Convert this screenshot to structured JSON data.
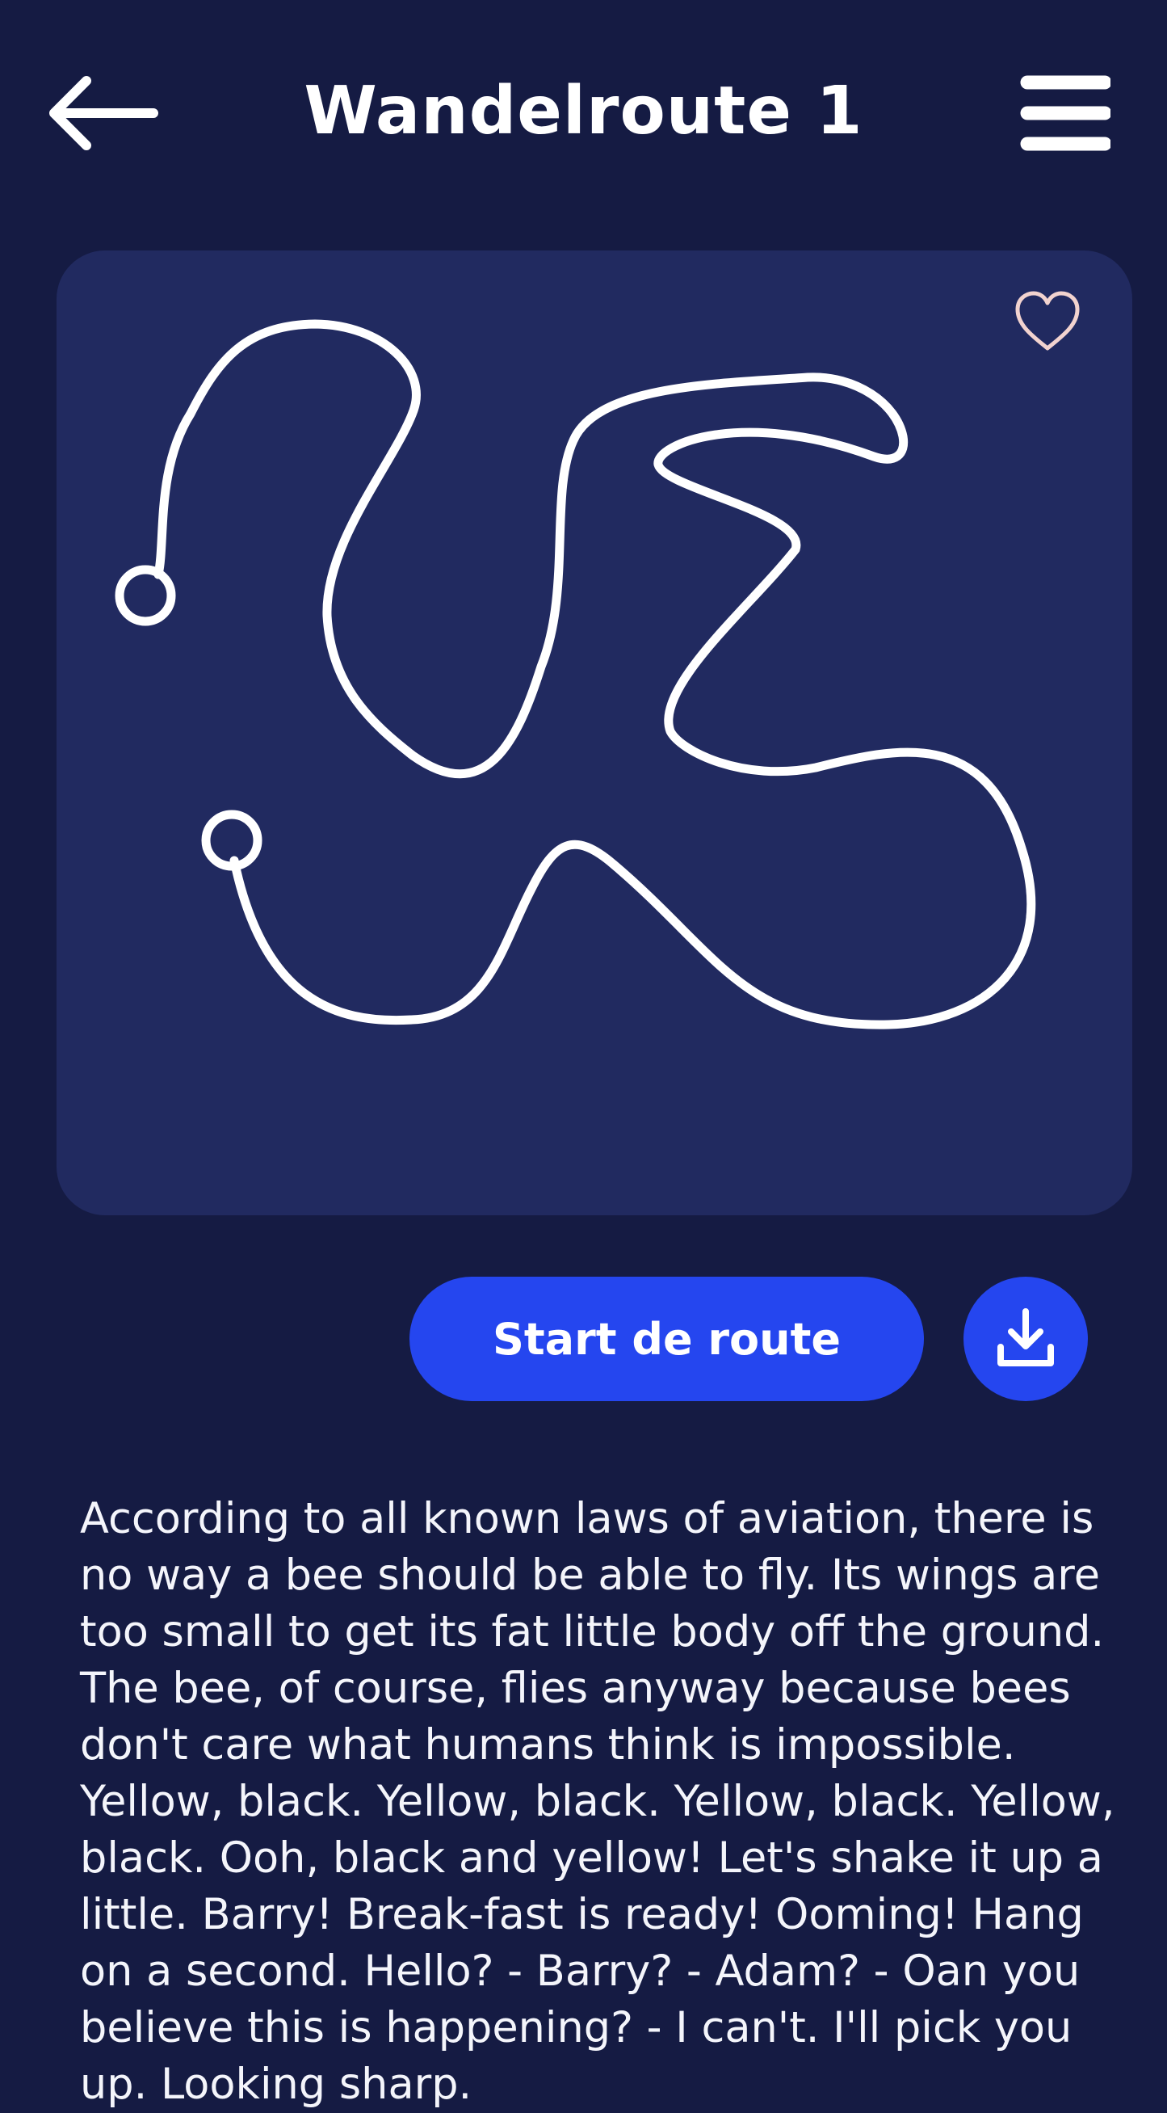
{
  "header": {
    "title": "Wandelroute 1",
    "back_icon": "arrow-left-icon",
    "menu_icon": "hamburger-menu-icon"
  },
  "map": {
    "favorite_icon": "heart-outline-icon",
    "route_icon": "route-path",
    "start_marker": "circle-marker",
    "end_marker": "circle-marker"
  },
  "actions": {
    "start_label": "Start de route",
    "download_icon": "download-icon"
  },
  "description": "According to all known laws of aviation, there is no way a bee should be able to fly. Its wings are too small to get its fat little body off the ground. The bee, of course, flies anyway because bees don't care what humans think is impossible. Yellow, black. Yellow, black. Yellow, black. Yellow, black. Ooh, black and yellow! Let's shake it up a little. Barry! Break-fast is ready! Ooming! Hang on a second. Hello? - Barry? - Adam? - Oan you believe this is happening? - I can't. I'll pick you up. Looking sharp.",
  "colors": {
    "background": "#151b43",
    "card": "#212a60",
    "accent": "#2546ef",
    "heart": "#f2d3cf",
    "text": "#ffffff"
  }
}
